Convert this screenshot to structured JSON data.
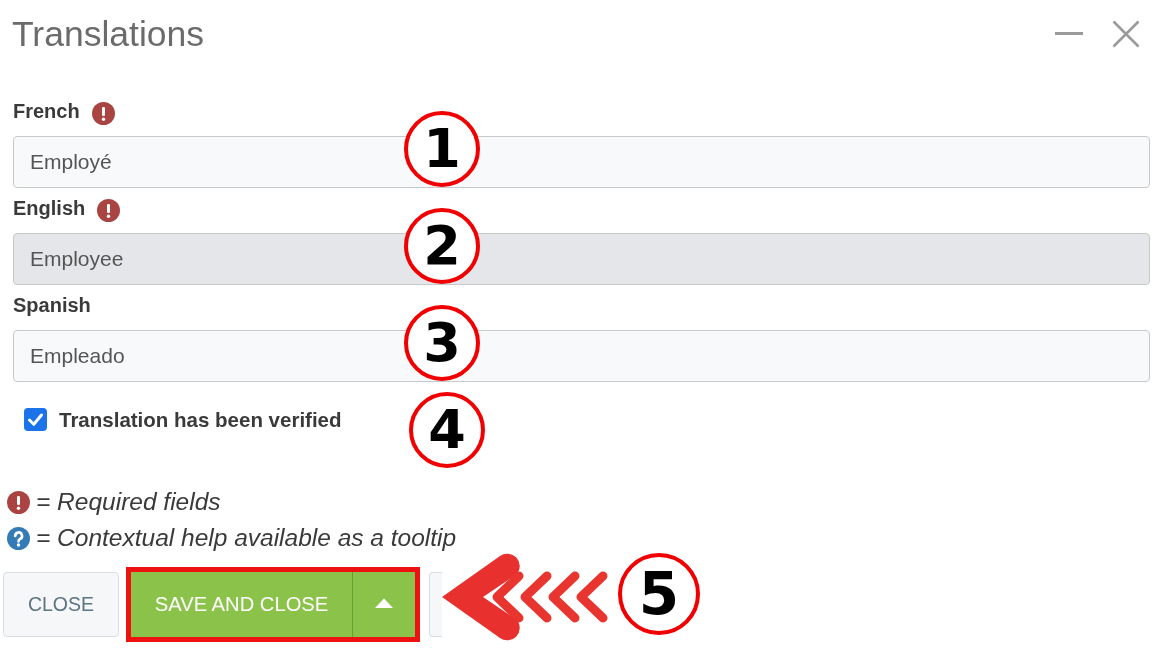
{
  "window": {
    "title": "Translations"
  },
  "fields": [
    {
      "label": "French",
      "required": true,
      "value": "Employé",
      "disabled": false,
      "callout": "1"
    },
    {
      "label": "English",
      "required": true,
      "value": "Employee",
      "disabled": true,
      "callout": "2"
    },
    {
      "label": "Spanish",
      "required": false,
      "value": "Empleado",
      "disabled": false,
      "callout": "3"
    }
  ],
  "verified": {
    "label": "Translation has been verified",
    "checked": true,
    "callout": "4"
  },
  "legend": [
    {
      "kind": "required",
      "text": "= Required fields"
    },
    {
      "kind": "help",
      "text": "= Contextual help available as a tooltip"
    }
  ],
  "buttons": [
    {
      "kind": "plain",
      "label": "CLOSE"
    },
    {
      "kind": "split",
      "label": "SAVE AND CLOSE",
      "highlighted": true,
      "callout": "5"
    },
    {
      "kind": "blank"
    }
  ]
}
